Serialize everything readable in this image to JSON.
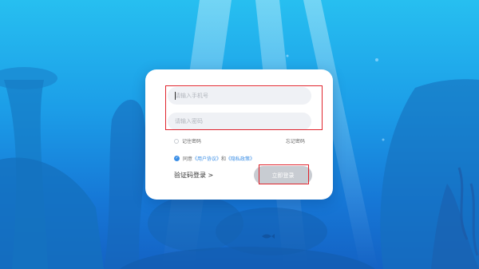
{
  "login": {
    "phone_placeholder": "请输入手机号",
    "password_placeholder": "请输入密码",
    "remember_label": "记住密码",
    "forgot_label": "忘记密码",
    "agree_prefix": "同意",
    "user_agreement": "《用户协议》",
    "and_text": "和",
    "privacy_policy": "《隐私政策》",
    "sms_login": "验证码登录 >",
    "submit_label": "立即登录",
    "agree_checked_icon": "check-icon"
  },
  "colors": {
    "highlight": "#e0242d",
    "link": "#3a8ee6",
    "submit_bg": "#c8ccd2",
    "bg_top": "#27bff0",
    "bg_bottom": "#1462c4"
  }
}
